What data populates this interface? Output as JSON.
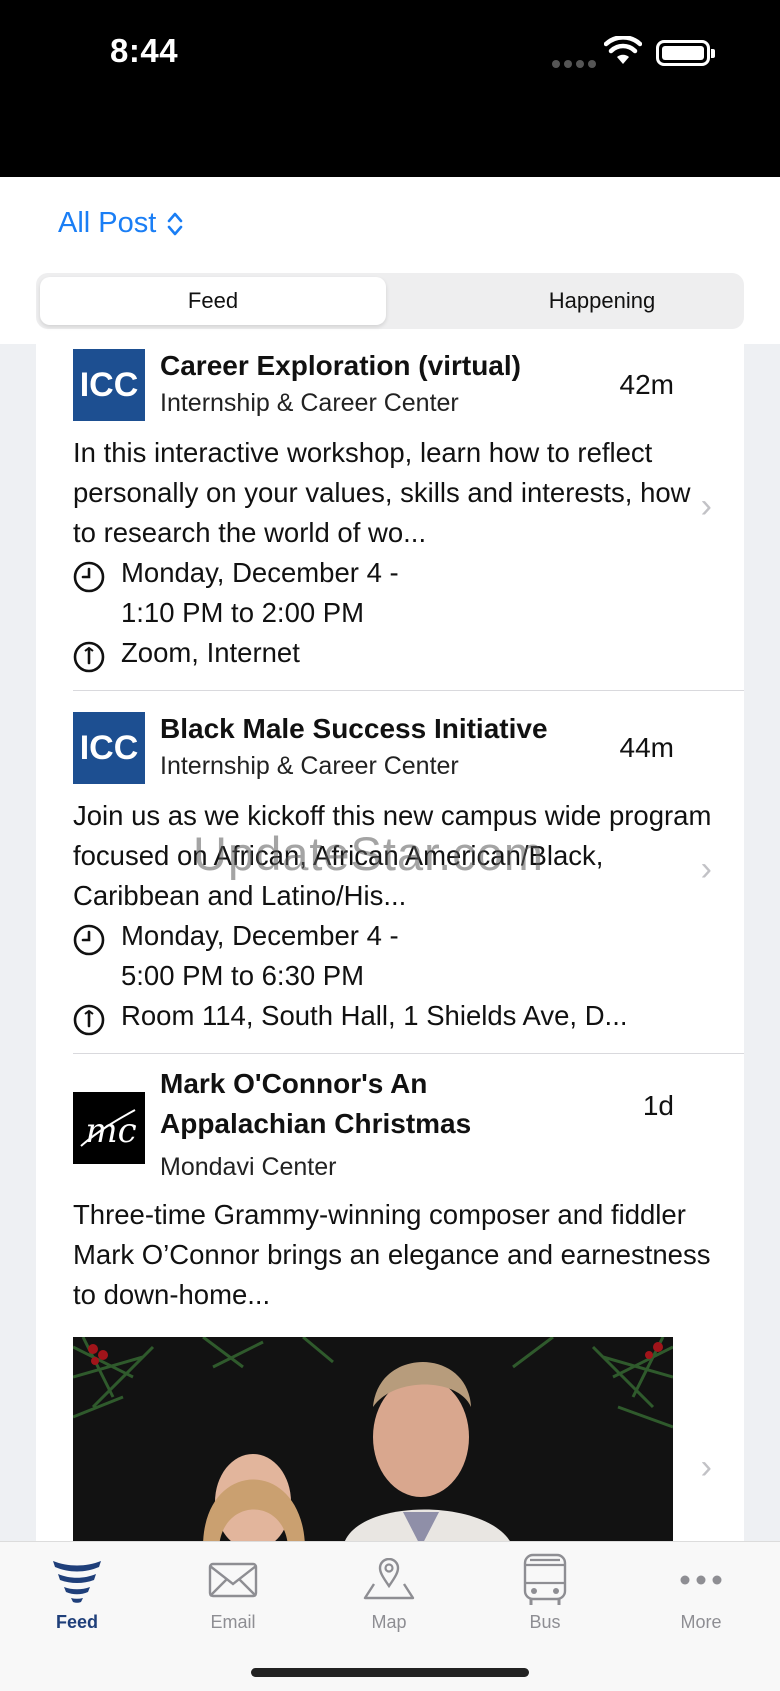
{
  "status_bar": {
    "time": "8:44"
  },
  "header": {
    "filter_label": "All Post",
    "segments": [
      "Feed",
      "Happening"
    ]
  },
  "posts": [
    {
      "logo_text": "ICC",
      "title": "Career Exploration (virtual)",
      "org": "Internship & Career Center",
      "age": "42m",
      "desc": "In this interactive workshop, learn how to reflect personally on your values, skills and interests, how to research the world of wo...",
      "date": "Monday, December 4 -",
      "time": "1:10 PM to 2:00 PM",
      "location": "Zoom, Internet"
    },
    {
      "logo_text": "ICC",
      "title": "Black Male Success Initiative",
      "org": "Internship & Career Center",
      "age": "44m",
      "desc": "Join us as we kickoff this new campus wide program focused on African, African American/Black, Caribbean and Latino/His...",
      "date": "Monday, December 4 -",
      "time": "5:00 PM to 6:30 PM",
      "location": "Room 114, South Hall, 1 Shields Ave, D..."
    },
    {
      "logo_text": "mc",
      "title_line1": "Mark O'Connor's An",
      "title_line2": "Appalachian Christmas",
      "org": "Mondavi Center",
      "age": "1d",
      "desc": "Three-time Grammy-winning composer and fiddler Mark O’Connor brings an elegance and earnestness to down-home..."
    }
  ],
  "watermark": "UpdateStar.com",
  "tab_bar": {
    "tabs": [
      {
        "label": "Feed",
        "icon": "feed-icon",
        "active": true
      },
      {
        "label": "Email",
        "icon": "envelope-icon"
      },
      {
        "label": "Map",
        "icon": "map-pin-icon"
      },
      {
        "label": "Bus",
        "icon": "bus-icon"
      },
      {
        "label": "More",
        "icon": "more-dots-icon"
      }
    ]
  },
  "colors": {
    "accent": "#1a7ef5",
    "active_tab": "#1f3f7a",
    "icc_blue": "#1d4f91"
  }
}
